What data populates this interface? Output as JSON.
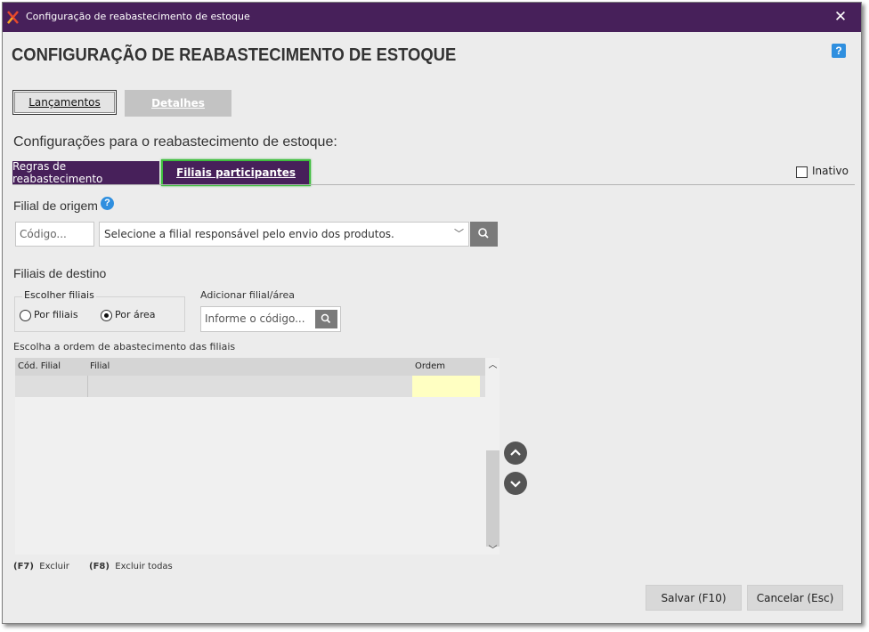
{
  "window": {
    "title": "Configuração de reabastecimento de estoque",
    "close_icon": "close-icon",
    "app_icon": "app-logo-icon"
  },
  "page": {
    "title": "CONFIGURAÇÃO DE REABASTECIMENTO DE ESTOQUE",
    "help_label": "?"
  },
  "top_buttons": {
    "lancamentos": "Lançamentos",
    "detalhes": "Detalhes"
  },
  "section": {
    "heading": "Configurações para o reabastecimento de estoque:"
  },
  "tabs": [
    {
      "label": "Regras de reabastecimento"
    },
    {
      "label": "Filiais participantes",
      "active": true
    }
  ],
  "inativo": {
    "label": "Inativo",
    "checked": false
  },
  "origem": {
    "label": "Filial de origem",
    "info_label": "?",
    "codigo_placeholder": "Código...",
    "select_text": "Selecione a filial responsável pelo envio dos produtos."
  },
  "destino": {
    "label": "Filiais de destino",
    "escolher_label": "Escolher filiais",
    "radio_por_filiais": "Por filiais",
    "radio_por_area": "Por área",
    "selected": "Por área",
    "adicionar_label": "Adicionar filial/área",
    "adicionar_placeholder": "Informe o código..."
  },
  "grid": {
    "caption": "Escolha a ordem de abastecimento das filiais",
    "columns": [
      "Cód. Filial",
      "Filial",
      "Ordem"
    ]
  },
  "shortcuts": {
    "f7_key": "(F7)",
    "f7_label": "Excluir",
    "f8_key": "(F8)",
    "f8_label": "Excluir todas"
  },
  "footer": {
    "save": "Salvar (F10)",
    "cancel": "Cancelar (Esc)"
  },
  "colors": {
    "brand": "#47205a",
    "highlight_border": "#3fbd3f",
    "ordem_cell": "#ffffc2",
    "help_blue": "#2f8fdf"
  }
}
